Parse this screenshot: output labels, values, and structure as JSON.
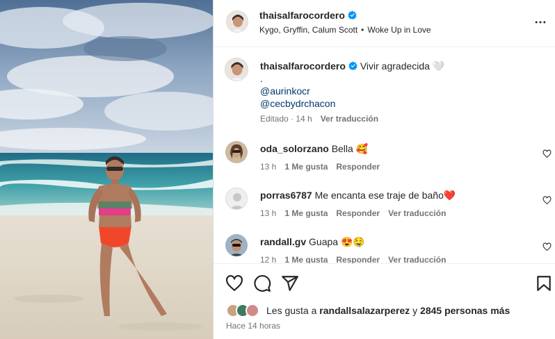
{
  "header": {
    "username": "thaisalfarocordero",
    "audio_artists": "Kygo, Gryffin, Calum Scott",
    "audio_separator": "•",
    "audio_title": "Woke Up in Love"
  },
  "caption": {
    "username": "thaisalfarocordero",
    "text": "Vivir agradecida 🤍",
    "dot_line": ".",
    "mentions": [
      "@aurinkocr",
      "@cecbydrchacon"
    ],
    "edited_time": "Editado · 14 h",
    "translate": "Ver traducción"
  },
  "comments": [
    {
      "username": "oda_solorzano",
      "text": "Bella 🥰",
      "time": "13 h",
      "likes": "1 Me gusta",
      "reply": "Responder",
      "translate": ""
    },
    {
      "username": "porras6787",
      "text": "Me encanta ese traje de baño❤️",
      "time": "13 h",
      "likes": "1 Me gusta",
      "reply": "Responder",
      "translate": "Ver traducción"
    },
    {
      "username": "randall.gv",
      "text": "Guapa 😍🤤",
      "time": "12 h",
      "likes": "1 Me gusta",
      "reply": "Responder",
      "translate": "Ver traducción"
    }
  ],
  "likes": {
    "prefix": "Les gusta a",
    "user": "randallsalazarperez",
    "connector": "y",
    "others": "2845 personas más"
  },
  "posted": "Hace 14 horas",
  "icons": {
    "verified": "verified-badge-icon",
    "more": "more-options-icon",
    "like": "heart-icon",
    "comment": "comment-bubble-icon",
    "share": "paper-plane-icon",
    "save": "bookmark-icon"
  },
  "colors": {
    "verified": "#0095f6",
    "mention": "#00376b",
    "muted": "#737373",
    "text": "#262626"
  }
}
